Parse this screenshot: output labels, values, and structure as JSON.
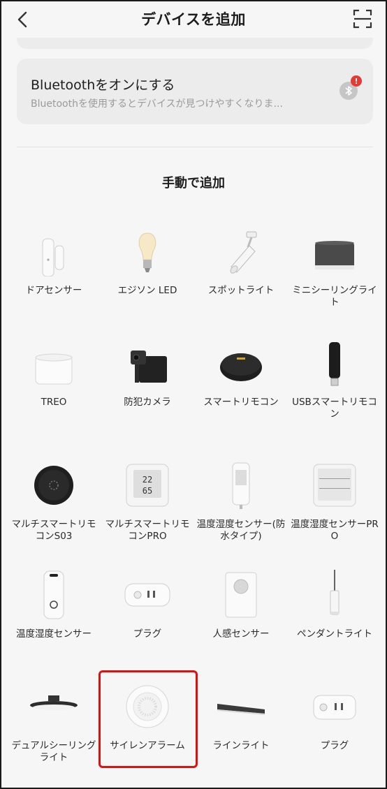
{
  "header": {
    "title": "デバイスを追加"
  },
  "bluetooth": {
    "title": "Bluetoothをオンにする",
    "subtitle": "Bluetoothを使用するとデバイスが見つけやすくなりま...",
    "alert_badge": "!"
  },
  "manual_section": {
    "title": "手動で追加"
  },
  "devices": [
    {
      "label": "ドアセンサー",
      "icon": "door-sensor-icon"
    },
    {
      "label": "エジソン LED",
      "icon": "edison-bulb-icon"
    },
    {
      "label": "スポットライト",
      "icon": "spotlight-icon"
    },
    {
      "label": "ミニシーリングライト",
      "icon": "mini-ceiling-light-icon"
    },
    {
      "label": "TREO",
      "icon": "treo-light-icon"
    },
    {
      "label": "防犯カメラ",
      "icon": "security-camera-icon"
    },
    {
      "label": "スマートリモコン",
      "icon": "smart-remote-icon"
    },
    {
      "label": "USBスマートリモコン",
      "icon": "usb-remote-icon"
    },
    {
      "label": "マルチスマートリモコンS03",
      "icon": "round-remote-icon"
    },
    {
      "label": "マルチスマートリモコンPRO",
      "icon": "thermo-display-icon"
    },
    {
      "label": "温度湿度センサー(防水タイプ)",
      "icon": "waterproof-sensor-icon"
    },
    {
      "label": "温度湿度センサーPRO",
      "icon": "sensor-pro-icon"
    },
    {
      "label": "温度湿度センサー",
      "icon": "thermo-hygro-sensor-icon"
    },
    {
      "label": "プラグ",
      "icon": "plug-icon"
    },
    {
      "label": "人感センサー",
      "icon": "motion-sensor-icon"
    },
    {
      "label": "ペンダントライト",
      "icon": "pendant-light-icon"
    },
    {
      "label": "デュアルシーリングライト",
      "icon": "dual-ceiling-light-icon"
    },
    {
      "label": "サイレンアラーム",
      "icon": "siren-alarm-icon"
    },
    {
      "label": "ラインライト",
      "icon": "line-light-icon"
    },
    {
      "label": "プラグ",
      "icon": "plug-mini-icon"
    }
  ],
  "highlighted_device_index": 17,
  "colors": {
    "highlight": "#e01010",
    "alert": "#e53935"
  }
}
